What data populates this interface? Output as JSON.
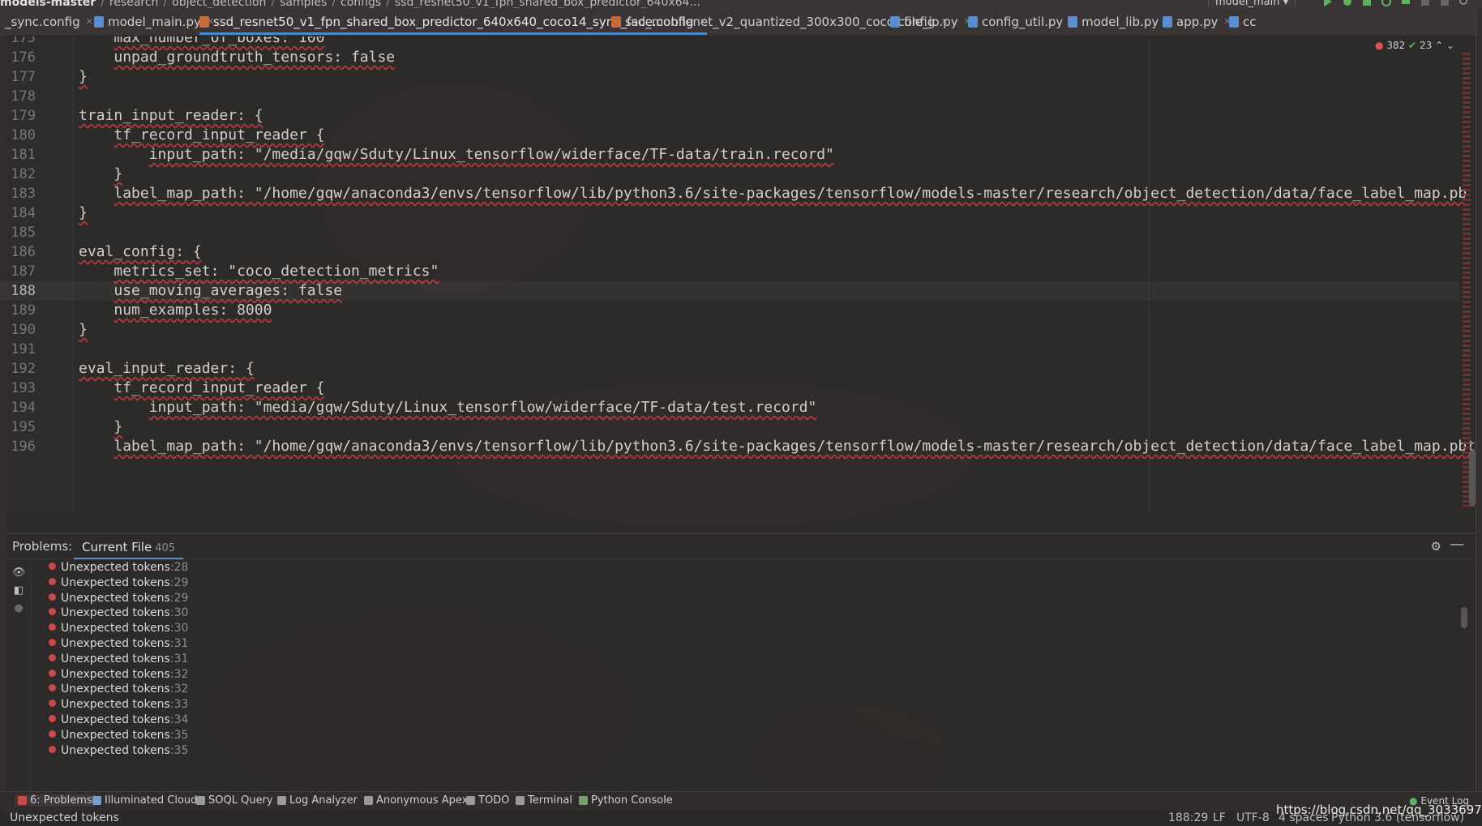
{
  "breadcrumb": [
    "models-master",
    "research",
    "object_detection",
    "samples",
    "configs",
    "ssd_resnet50_v1_fpn_shared_box_predictor_640x64..."
  ],
  "run_config": "model_main",
  "tabs": [
    {
      "label": "_sync.config",
      "active": false
    },
    {
      "label": "model_main.py",
      "active": false
    },
    {
      "label": "ssd_resnet50_v1_fpn_shared_box_predictor_640x640_coco14_sync_face.config",
      "active": true
    },
    {
      "label": "ssd_mobilenet_v2_quantized_300x300_coco.config",
      "active": false
    },
    {
      "label": "file_io.py",
      "active": false
    },
    {
      "label": "config_util.py",
      "active": false
    },
    {
      "label": "model_lib.py",
      "active": false
    },
    {
      "label": "app.py",
      "active": false
    },
    {
      "label": "cc",
      "active": false
    }
  ],
  "inspection": {
    "errors": "382",
    "ok": "23"
  },
  "code": [
    {
      "n": "175",
      "text": "  max_number_of_boxes: 100"
    },
    {
      "n": "176",
      "text": "  unpad_groundtruth_tensors: false"
    },
    {
      "n": "177",
      "text": "}"
    },
    {
      "n": "178",
      "text": ""
    },
    {
      "n": "179",
      "text": "train_input_reader: {"
    },
    {
      "n": "180",
      "text": "  tf_record_input_reader {"
    },
    {
      "n": "181",
      "text": "    input_path: \"/media/gqw/Sduty/Linux_tensorflow/widerface/TF-data/train.record\""
    },
    {
      "n": "182",
      "text": "  }"
    },
    {
      "n": "183",
      "text": "  label_map_path: \"/home/gqw/anaconda3/envs/tensorflow/lib/python3.6/site-packages/tensorflow/models-master/research/object_detection/data/face_label_map.pb"
    },
    {
      "n": "184",
      "text": "}"
    },
    {
      "n": "185",
      "text": ""
    },
    {
      "n": "186",
      "text": "eval_config: {"
    },
    {
      "n": "187",
      "text": "  metrics_set: \"coco_detection_metrics\""
    },
    {
      "n": "188",
      "text": "  use_moving_averages: false"
    },
    {
      "n": "189",
      "text": "  num_examples: 8000"
    },
    {
      "n": "190",
      "text": "}"
    },
    {
      "n": "191",
      "text": ""
    },
    {
      "n": "192",
      "text": "eval_input_reader: {"
    },
    {
      "n": "193",
      "text": "  tf_record_input_reader {"
    },
    {
      "n": "194",
      "text": "    input_path: \"media/gqw/Sduty/Linux_tensorflow/widerface/TF-data/test.record\""
    },
    {
      "n": "195",
      "text": "  }"
    },
    {
      "n": "196",
      "text": "  label_map_path: \"/home/gqw/anaconda3/envs/tensorflow/lib/python3.6/site-packages/tensorflow/models-master/research/object_detection/data/face_label_map.pbt"
    }
  ],
  "current_line": "188",
  "problems": {
    "title": "Problems:",
    "tab_label": "Current File",
    "tab_count": "405",
    "items": [
      {
        "text": "Unexpected tokens",
        "line": ":28"
      },
      {
        "text": "Unexpected tokens",
        "line": ":29"
      },
      {
        "text": "Unexpected tokens",
        "line": ":29"
      },
      {
        "text": "Unexpected tokens",
        "line": ":30"
      },
      {
        "text": "Unexpected tokens",
        "line": ":30"
      },
      {
        "text": "Unexpected tokens",
        "line": ":31"
      },
      {
        "text": "Unexpected tokens",
        "line": ":31"
      },
      {
        "text": "Unexpected tokens",
        "line": ":32"
      },
      {
        "text": "Unexpected tokens",
        "line": ":32"
      },
      {
        "text": "Unexpected tokens",
        "line": ":33"
      },
      {
        "text": "Unexpected tokens",
        "line": ":34"
      },
      {
        "text": "Unexpected tokens",
        "line": ":35"
      },
      {
        "text": "Unexpected tokens",
        "line": ":35"
      }
    ]
  },
  "tool_windows": [
    "6: Problems",
    "Illuminated Cloud",
    "SOQL Query",
    "Log Analyzer",
    "Anonymous Apex",
    "TODO",
    "Terminal",
    "Python Console"
  ],
  "event_log": "Event Log",
  "status": {
    "message": "Unexpected tokens",
    "position": "188:29",
    "line_sep": "LF",
    "encoding": "UTF-8",
    "indent": "4 spaces",
    "interpreter": "Python 3.6 (tensorflow)"
  },
  "watermark": "https://blog.csdn.net/qq_30336973",
  "colors": {
    "accent": "#4a88c7",
    "error": "#c84a4a",
    "ok": "#5fb061"
  }
}
